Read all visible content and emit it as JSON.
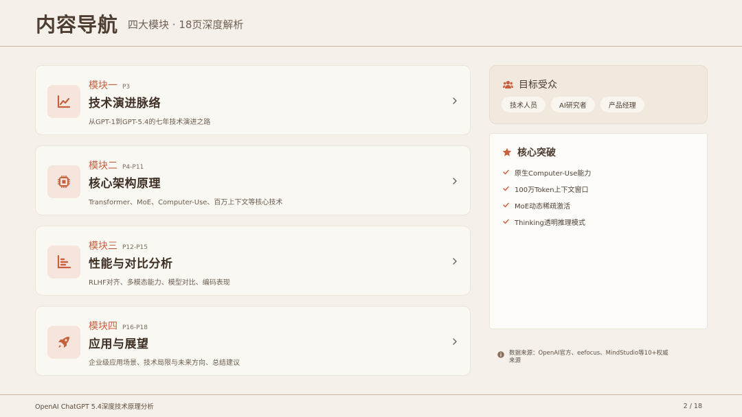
{
  "header": {
    "title": "内容导航",
    "subtitle": "四大模块 · 18页深度解析"
  },
  "modules": [
    {
      "label": "模块一",
      "pages": "P3",
      "name": "技术演进脉络",
      "desc": "从GPT-1到GPT-5.4的七年技术演进之路",
      "icon": "line-chart-icon"
    },
    {
      "label": "模块二",
      "pages": "P4-P11",
      "name": "核心架构原理",
      "desc": "Transformer、MoE、Computer-Use、百万上下文等核心技术",
      "icon": "chip-icon"
    },
    {
      "label": "模块三",
      "pages": "P12-P15",
      "name": "性能与对比分析",
      "desc": "RLHF对齐、多模态能力、模型对比、编码表现",
      "icon": "bar-chart-icon"
    },
    {
      "label": "模块四",
      "pages": "P16-P18",
      "name": "应用与展望",
      "desc": "企业级应用场景、技术局限与未来方向、总结建议",
      "icon": "rocket-icon"
    }
  ],
  "audience": {
    "title": "目标受众",
    "tags": [
      "技术人员",
      "AI研究者",
      "产品经理"
    ]
  },
  "breakthrough": {
    "title": "核心突破",
    "items": [
      "原生Computer-Use能力",
      "100万Token上下文窗口",
      "MoE动态稀疏激活",
      "Thinking透明推理模式"
    ]
  },
  "source": "数据来源：OpenAI官方、eefocus、MindStudio等10+权威来源",
  "footer": {
    "left": "OpenAI ChatGPT 5.4深度技术原理分析",
    "page": "2 / 18"
  },
  "colors": {
    "accent": "#c8603e",
    "background": "#f5f1ea",
    "text": "#4a3b30"
  }
}
